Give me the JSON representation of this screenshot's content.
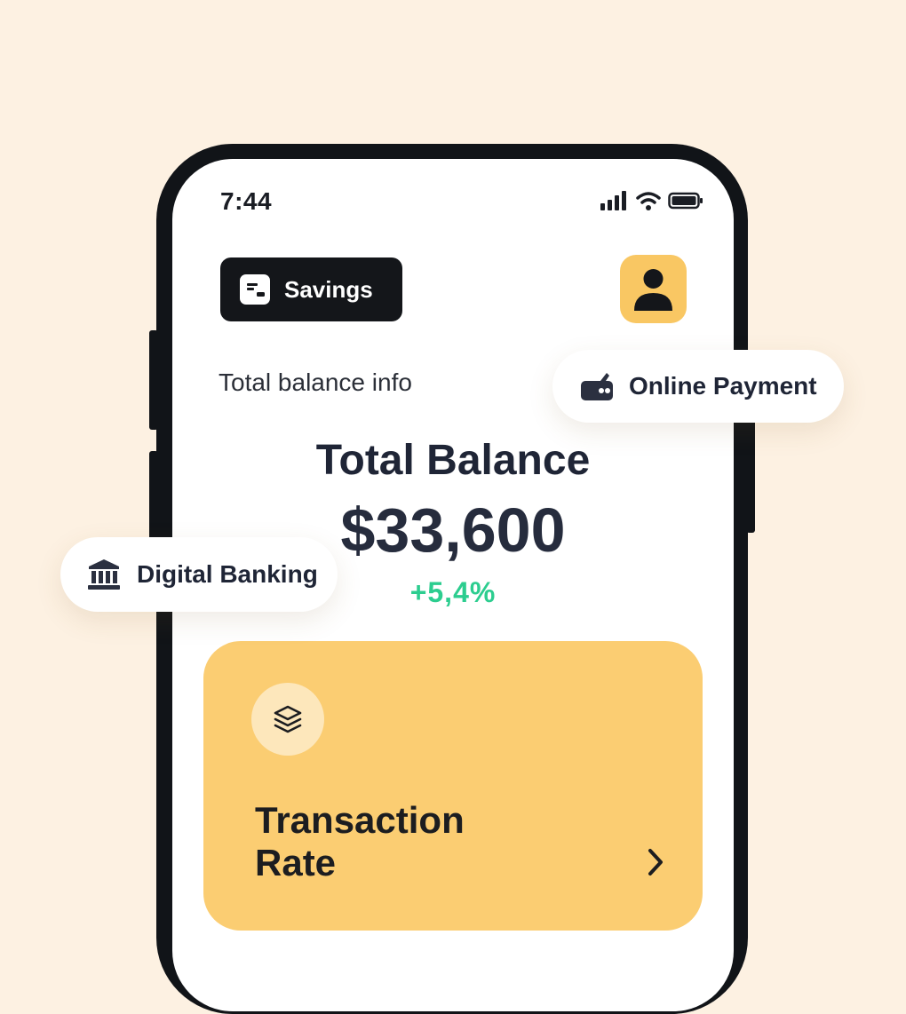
{
  "status_bar": {
    "time": "7:44",
    "icons": [
      "signal-icon",
      "wifi-icon",
      "battery-icon"
    ]
  },
  "header": {
    "account_label": "Savings",
    "account_icon": "card-icon",
    "avatar_icon": "user-icon"
  },
  "balance": {
    "info_label": "Total balance info",
    "title": "Total Balance",
    "amount": "$33,600",
    "change": "+5,4%"
  },
  "card": {
    "title": "Transaction\nRate",
    "icon": "layers-icon",
    "arrow_icon": "chevron-right-icon"
  },
  "floating_pills": {
    "online_payment": "Online Payment",
    "digital_banking": "Digital Banking"
  },
  "colors": {
    "background": "#fdf1e2",
    "accent_yellow": "#f9c763",
    "card_yellow": "#fbcd72",
    "positive_green": "#2ccd8f",
    "dark": "#14161a"
  }
}
